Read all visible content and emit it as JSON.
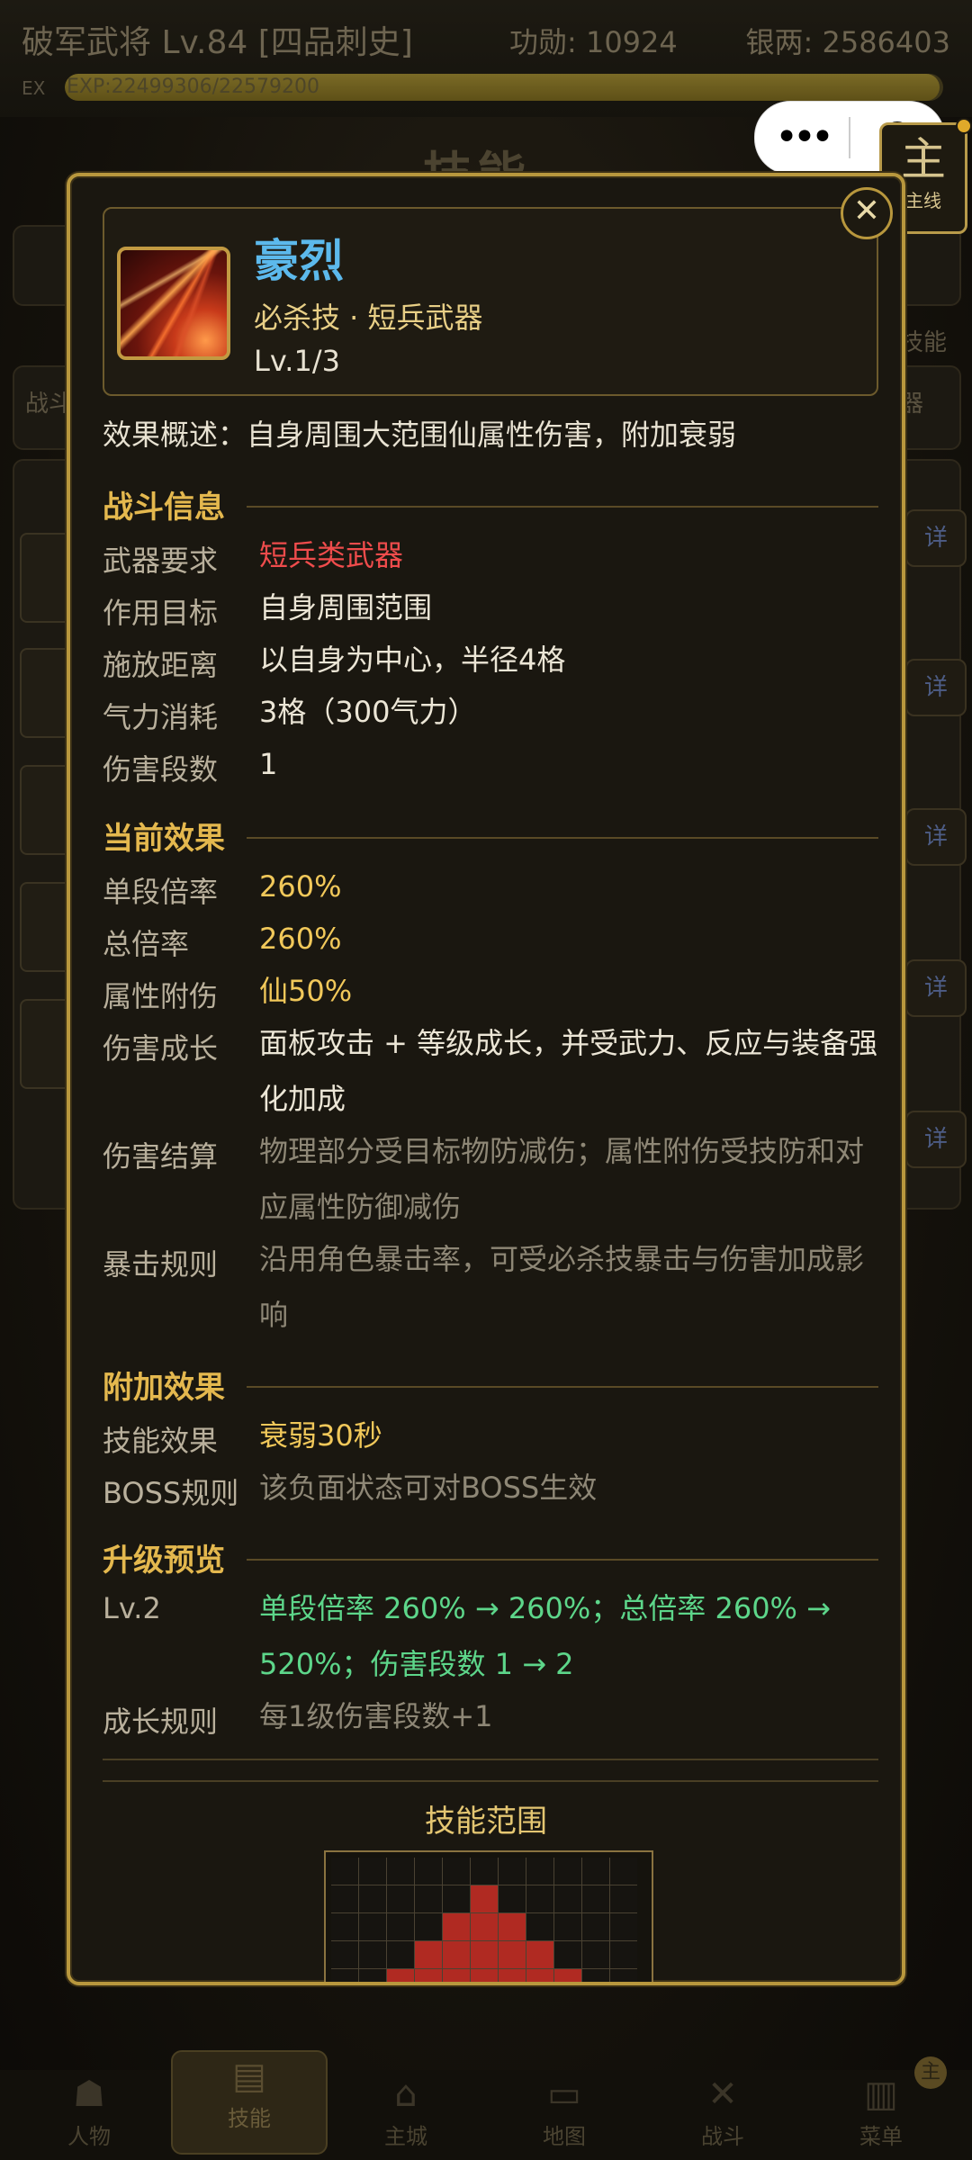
{
  "header": {
    "title": "破军武将 Lv.84 [四品刺史]",
    "merit": "功勋: 10924",
    "silver": "银两: 2586403",
    "ex_label": "EX",
    "exp_text": "EXP:22499306/22579200",
    "exp_progress": 0.996
  },
  "capsule": {
    "more_icon": "more-dots-icon",
    "record_icon": "target-icon"
  },
  "quest_badge": {
    "glyph": "主",
    "label": "主线"
  },
  "background": {
    "heading": "技能",
    "tag_left": "战斗",
    "tag_right_1": "技能",
    "tag_right_2": "器",
    "detail_btn": "详"
  },
  "bottom_nav": [
    {
      "label": "人物",
      "icon": "person-icon"
    },
    {
      "label": "技能",
      "icon": "scroll-icon"
    },
    {
      "label": "主城",
      "icon": "castle-icon"
    },
    {
      "label": "地图",
      "icon": "map-icon"
    },
    {
      "label": "战斗",
      "icon": "swords-icon"
    },
    {
      "label": "菜单",
      "icon": "menu-icon"
    }
  ],
  "corner_badge": "主",
  "modal": {
    "close": "✕",
    "skill": {
      "name": "豪烈",
      "type": "必杀技 · 短兵武器",
      "level": "Lv.1/3"
    },
    "summary": "效果概述：自身周围大范围仙属性伤害，附加衰弱",
    "sections": {
      "battle": "战斗信息",
      "current": "当前效果",
      "extra": "附加效果",
      "upgrade": "升级预览"
    },
    "battle_info": [
      {
        "label": "武器要求",
        "value": "短兵类武器"
      },
      {
        "label": "作用目标",
        "value": "自身周围范围"
      },
      {
        "label": "施放距离",
        "value": "以自身为中心，半径4格"
      },
      {
        "label": "气力消耗",
        "value": "3格（300气力）"
      },
      {
        "label": "伤害段数",
        "value": "1"
      }
    ],
    "current_effect": [
      {
        "label": "单段倍率",
        "value": "260%"
      },
      {
        "label": "总倍率",
        "value": "260%"
      },
      {
        "label": "属性附伤",
        "value": "仙50%"
      },
      {
        "label": "伤害成长",
        "value": "面板攻击 + 等级成长，并受武力、反应与装备强化加成"
      },
      {
        "label": "伤害结算",
        "value": "物理部分受目标物防减伤；属性附伤受技防和对应属性防御减伤"
      },
      {
        "label": "暴击规则",
        "value": "沿用角色暴击率，可受必杀技暴击与伤害加成影响"
      }
    ],
    "extra_effect": [
      {
        "label": "技能效果",
        "value": "衰弱30秒"
      },
      {
        "label": "BOSS规则",
        "value": "该负面状态可对BOSS生效"
      }
    ],
    "upgrade_preview": [
      {
        "label": "Lv.2",
        "value": "单段倍率 260% → 260%；总倍率 260% → 520%；伤害段数 1 → 2"
      },
      {
        "label": "成长规则",
        "value": "每1级伤害段数+1"
      }
    ],
    "range_title": "技能范围",
    "range_grid": {
      "cols": 11,
      "rows": 6,
      "active": [
        [
          1,
          5
        ],
        [
          2,
          4
        ],
        [
          2,
          5
        ],
        [
          2,
          6
        ],
        [
          3,
          3
        ],
        [
          3,
          4
        ],
        [
          3,
          5
        ],
        [
          3,
          6
        ],
        [
          3,
          7
        ],
        [
          4,
          2
        ],
        [
          4,
          3
        ],
        [
          4,
          4
        ],
        [
          4,
          5
        ],
        [
          4,
          6
        ],
        [
          4,
          7
        ],
        [
          4,
          8
        ]
      ]
    }
  },
  "colors": {
    "accent_gold": "#e4b84e",
    "skill_name_blue": "#5cb9ec",
    "weapon_red": "#ef4c4c",
    "value_gold": "#f1c85a",
    "upgrade_green": "#5dd68a",
    "range_red": "#b02a22"
  }
}
